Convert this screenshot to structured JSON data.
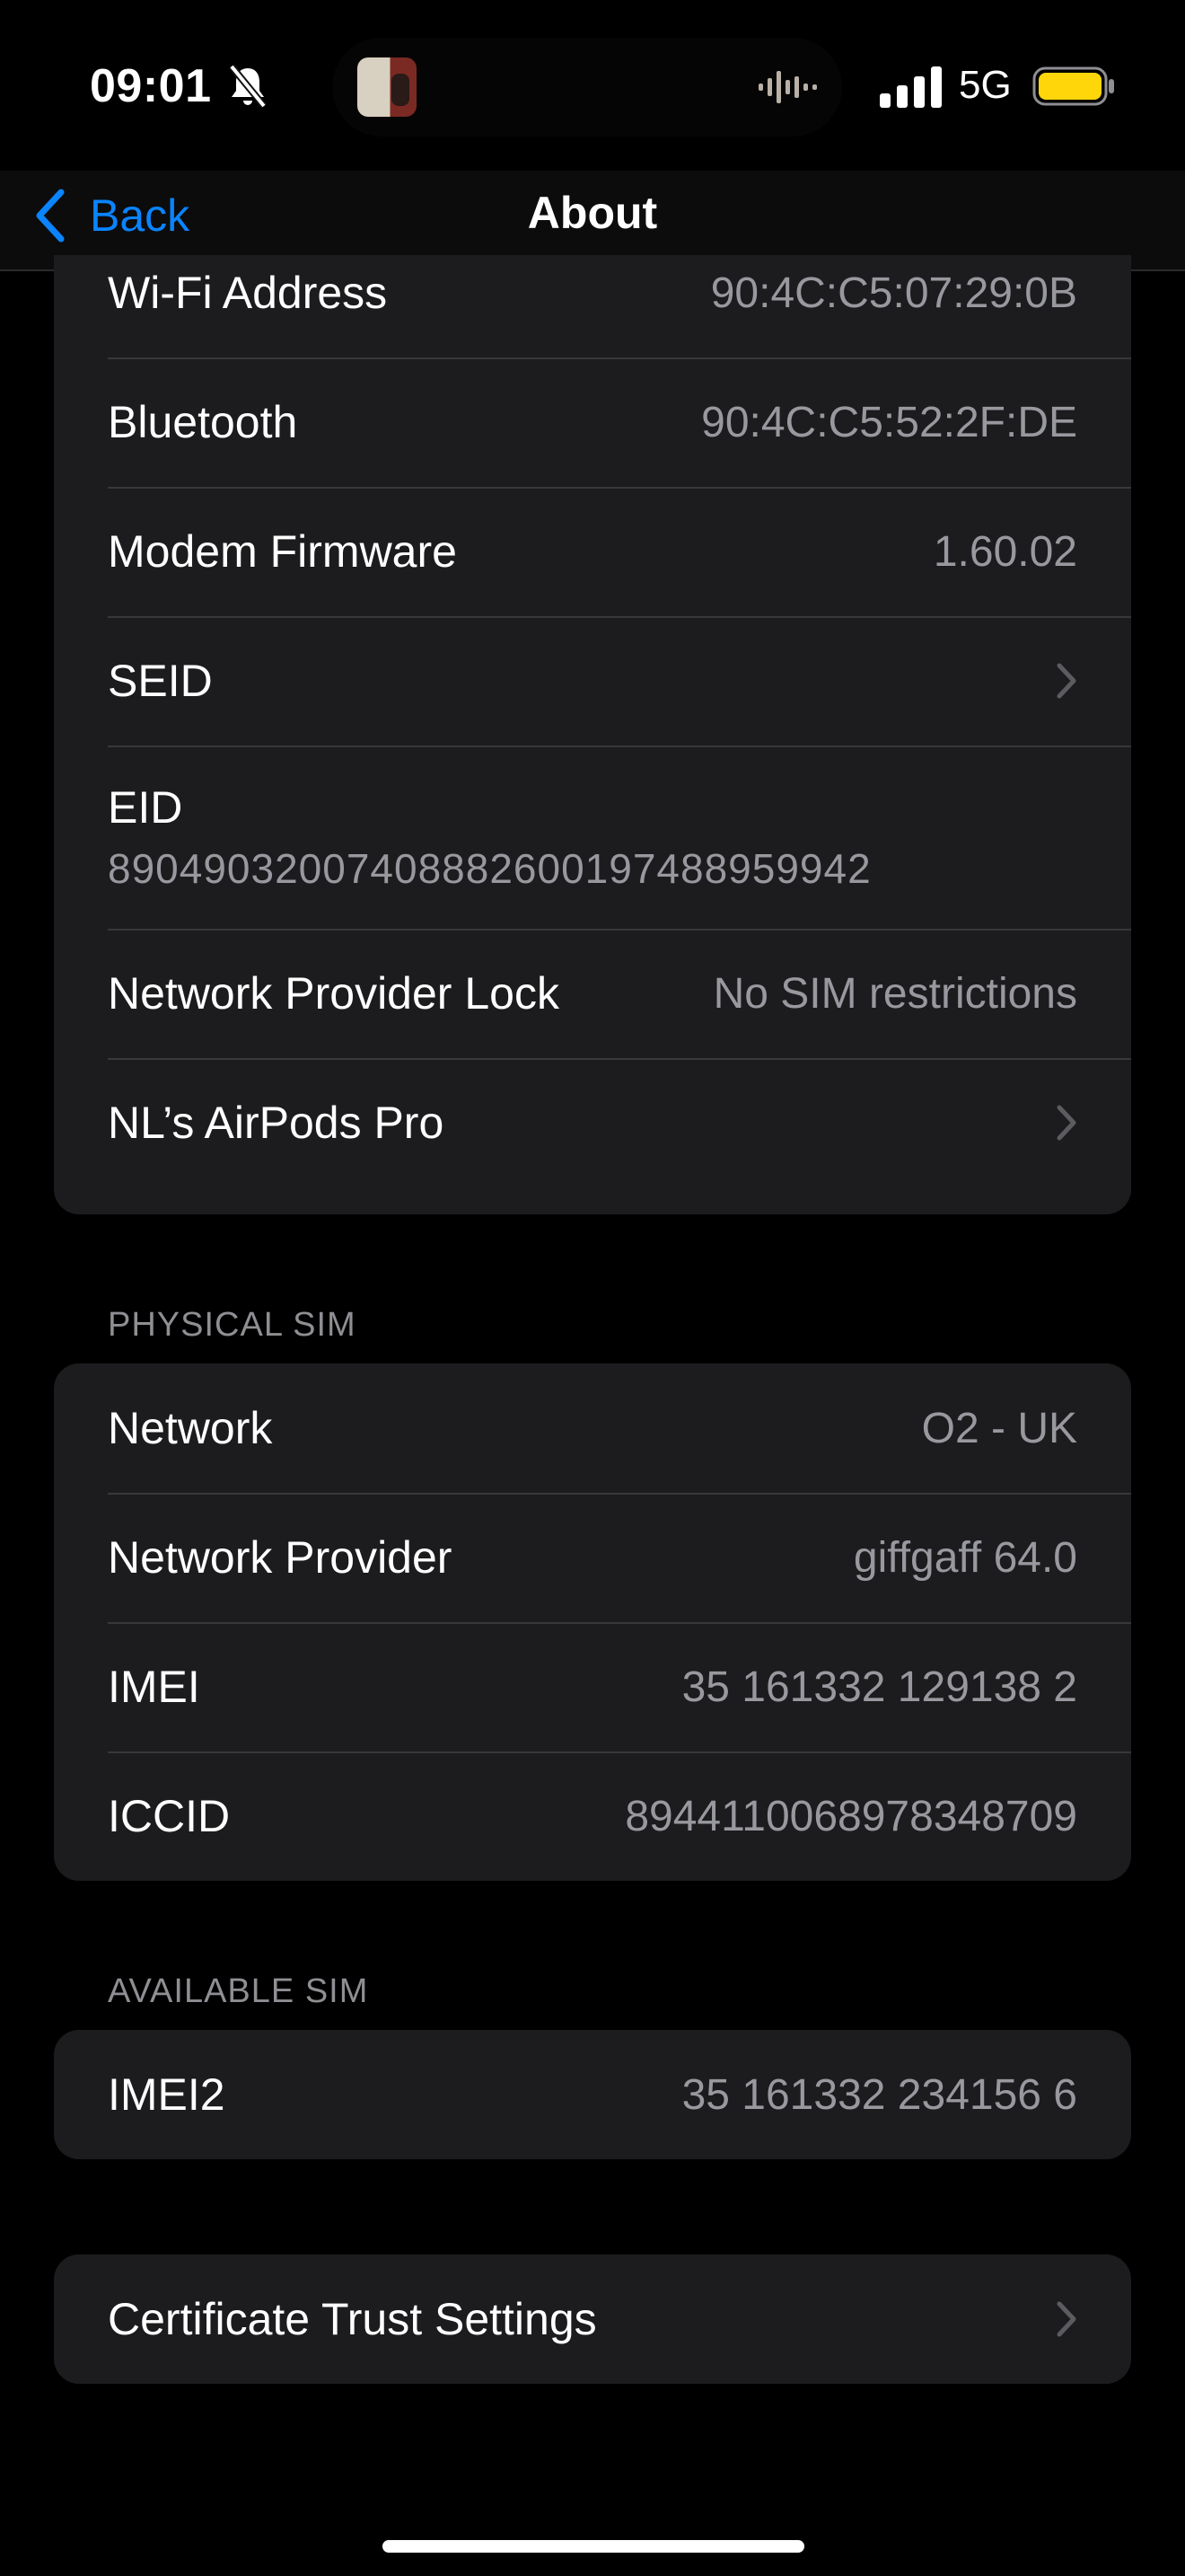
{
  "status": {
    "time": "09:01",
    "network": "5G"
  },
  "nav": {
    "back_label": "Back",
    "title": "About"
  },
  "top_group": [
    {
      "label": "Wi-Fi Address",
      "value": "90:4C:C5:07:29:0B"
    },
    {
      "label": "Bluetooth",
      "value": "90:4C:C5:52:2F:DE"
    },
    {
      "label": "Modem Firmware",
      "value": "1.60.02"
    },
    {
      "label": "SEID",
      "value": ""
    },
    {
      "label": "EID",
      "value": "89049032007408882600197488959942"
    },
    {
      "label": "Network Provider Lock",
      "value": "No SIM restrictions"
    },
    {
      "label": "NL’s AirPods Pro",
      "value": ""
    }
  ],
  "physical_sim": {
    "header": "PHYSICAL SIM",
    "rows": [
      {
        "label": "Network",
        "value": "O2 - UK"
      },
      {
        "label": "Network Provider",
        "value": "giffgaff 64.0"
      },
      {
        "label": "IMEI",
        "value": "35 161332 129138 2"
      },
      {
        "label": "ICCID",
        "value": "8944110068978348709"
      }
    ]
  },
  "available_sim": {
    "header": "AVAILABLE SIM",
    "rows": [
      {
        "label": "IMEI2",
        "value": "35 161332 234156 6"
      }
    ]
  },
  "certificate": {
    "label": "Certificate Trust Settings"
  },
  "colors": {
    "accent": "#0a84ff",
    "battery": "#ffd60a",
    "background": "#000000",
    "cell": "#1c1c1e"
  }
}
